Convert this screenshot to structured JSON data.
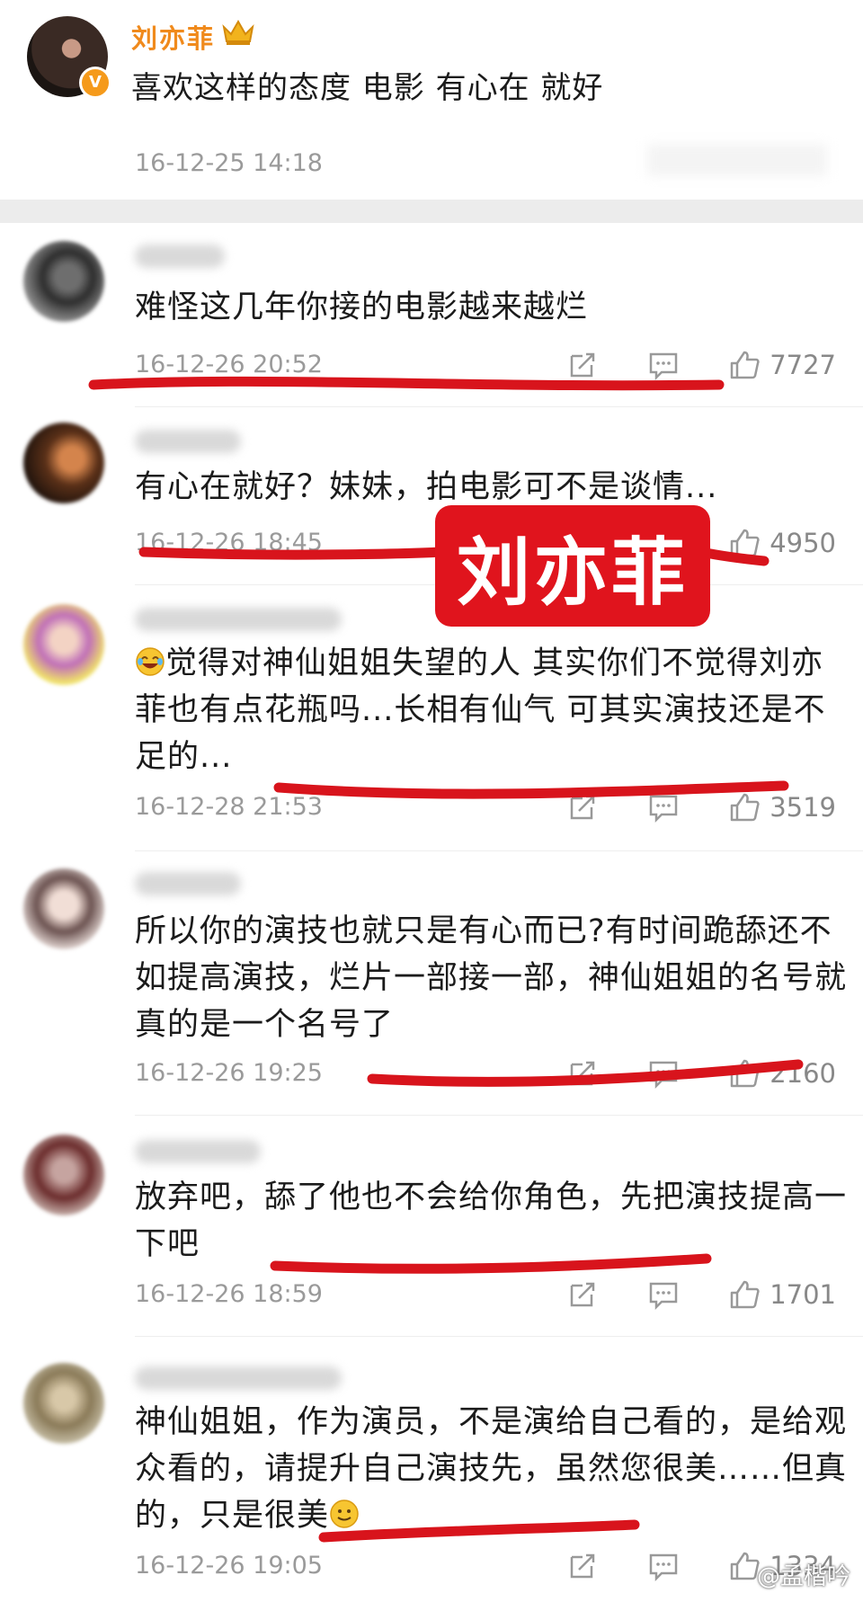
{
  "post": {
    "author": "刘亦菲",
    "text": "喜欢这样的态度 电影 有心在 就好",
    "time": "16-12-25 14:18",
    "crown_icon": "crown-icon",
    "verified_icon": "verified-badge-icon"
  },
  "comments": [
    {
      "text": "难怪这几年你接的电影越来越烂",
      "time": "16-12-26 20:52",
      "likes": "7727"
    },
    {
      "text": "有心在就好？妹妹，拍电影可不是谈情...",
      "time": "16-12-26 18:45",
      "likes": "4950"
    },
    {
      "text_lines": [
        "觉得对神仙姐姐失望的人 其实你们不觉得刘亦",
        "菲也有点花瓶吗...长相有仙气 可其实演技还是不",
        "足的..."
      ],
      "time": "16-12-28 21:53",
      "likes": "3519"
    },
    {
      "text_lines": [
        "所以你的演技也就只是有心而已?有时间跪舔还不",
        "如提高演技，烂片一部接一部，神仙姐姐的名号就",
        "真的是一个名号了"
      ],
      "time": "16-12-26 19:25",
      "likes": "2160"
    },
    {
      "text_lines": [
        "放弃吧，舔了他也不会给你角色，先把演技提高一",
        "下吧"
      ],
      "time": "16-12-26 18:59",
      "likes": "1701"
    },
    {
      "text_lines": [
        "神仙姐姐，作为演员，不是演给自己看的，是给观",
        "众看的，请提升自己演技先，虽然您很美……但真",
        "的，只是很美"
      ],
      "time": "16-12-26 19:05",
      "likes": "1334"
    }
  ],
  "overlay_label": "刘亦菲",
  "watermark": "@孟楷吟",
  "colors": {
    "annotation_red": "#d8141c",
    "badge_red": "#e0141d",
    "author_orange": "#f08a1c"
  },
  "icons": {
    "share": "share-icon",
    "comment": "comment-icon",
    "like": "thumbs-up-icon",
    "emoji_laugh": "laughing-emoji-icon",
    "emoji_smile": "smile-emoji-icon"
  }
}
